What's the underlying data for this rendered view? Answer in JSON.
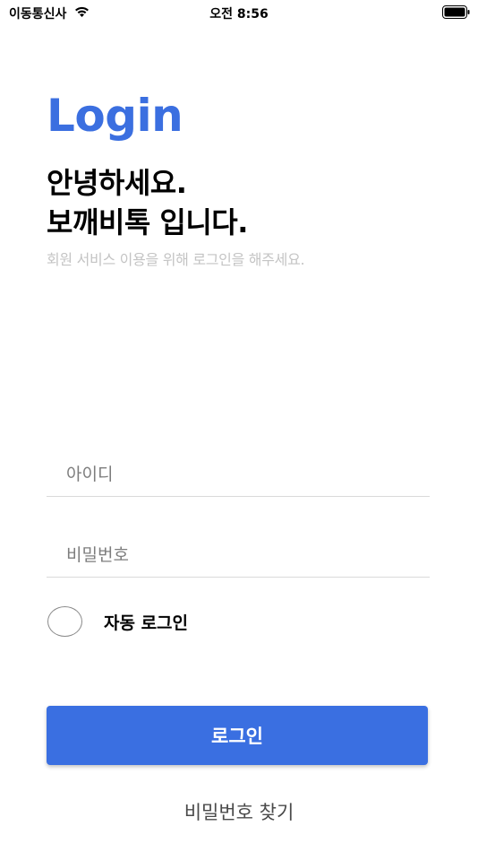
{
  "status_bar": {
    "carrier": "이동통신사",
    "time": "오전 8:56",
    "wifi_icon": "wifi-icon",
    "battery_icon": "battery-full-icon"
  },
  "header": {
    "title": "Login",
    "greeting_line1": "안녕하세요.",
    "greeting_line2": "보깨비톡 입니다.",
    "subtitle": "회원 서비스 이용을 위해 로그인을 해주세요."
  },
  "form": {
    "id_placeholder": "아이디",
    "id_value": "",
    "password_placeholder": "비밀번호",
    "password_value": "",
    "auto_login_label": "자동 로그인",
    "auto_login_checked": false
  },
  "actions": {
    "login_label": "로그인",
    "find_password_label": "비밀번호 찾기"
  },
  "colors": {
    "accent": "#3a6fe1",
    "title": "#3b6fe0",
    "subtitle": "#c4c4c4",
    "divider": "#dadada"
  }
}
